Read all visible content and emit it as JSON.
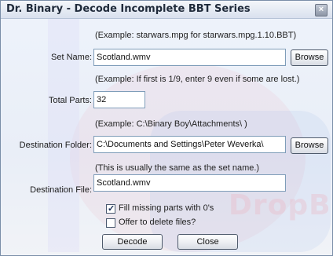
{
  "window": {
    "title": "Dr. Binary - Decode Incomplete BBT Series"
  },
  "watermark": "DropB",
  "set_name": {
    "hint": "(Example: starwars.mpg for starwars.mpg.1.10.BBT)",
    "label": "Set Name:",
    "value": "Scotland.wmv",
    "browse_label": "Browse"
  },
  "total_parts": {
    "hint": "(Example: If first is 1/9, enter 9 even if some are lost.)",
    "label": "Total Parts:",
    "value": "32"
  },
  "destination_folder": {
    "hint": "(Example: C:\\Binary Boy\\Attachments\\ )",
    "label": "Destination Folder:",
    "value": "C:\\Documents and Settings\\Peter Weverka\\",
    "browse_label": "Browse"
  },
  "destination_file": {
    "hint": "(This is usually the same as the set name.)",
    "label": "Destination File:",
    "value": "Scotland.wmv"
  },
  "options": {
    "fill_missing": {
      "label": "Fill missing parts with 0's",
      "checked": true
    },
    "offer_delete": {
      "label": "Offer to delete files?",
      "checked": false
    }
  },
  "buttons": {
    "decode": "Decode",
    "close": "Close"
  }
}
